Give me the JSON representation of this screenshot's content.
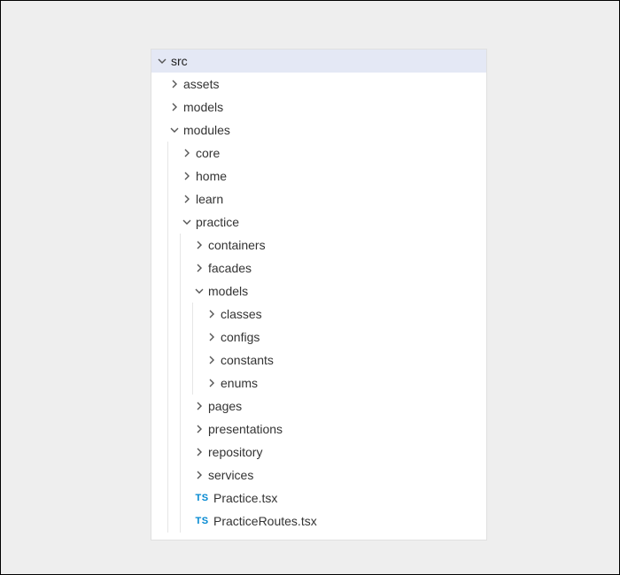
{
  "tree": [
    {
      "id": "src",
      "depth": 0,
      "type": "folder",
      "expanded": true,
      "selected": true,
      "label": "src"
    },
    {
      "id": "assets",
      "depth": 1,
      "type": "folder",
      "expanded": false,
      "selected": false,
      "label": "assets"
    },
    {
      "id": "models-top",
      "depth": 1,
      "type": "folder",
      "expanded": false,
      "selected": false,
      "label": "models"
    },
    {
      "id": "modules",
      "depth": 1,
      "type": "folder",
      "expanded": true,
      "selected": false,
      "label": "modules"
    },
    {
      "id": "core",
      "depth": 2,
      "type": "folder",
      "expanded": false,
      "selected": false,
      "label": "core"
    },
    {
      "id": "home",
      "depth": 2,
      "type": "folder",
      "expanded": false,
      "selected": false,
      "label": "home"
    },
    {
      "id": "learn",
      "depth": 2,
      "type": "folder",
      "expanded": false,
      "selected": false,
      "label": "learn"
    },
    {
      "id": "practice",
      "depth": 2,
      "type": "folder",
      "expanded": true,
      "selected": false,
      "label": "practice"
    },
    {
      "id": "containers",
      "depth": 3,
      "type": "folder",
      "expanded": false,
      "selected": false,
      "label": "containers"
    },
    {
      "id": "facades",
      "depth": 3,
      "type": "folder",
      "expanded": false,
      "selected": false,
      "label": "facades"
    },
    {
      "id": "models-practice",
      "depth": 3,
      "type": "folder",
      "expanded": true,
      "selected": false,
      "label": "models"
    },
    {
      "id": "classes",
      "depth": 4,
      "type": "folder",
      "expanded": false,
      "selected": false,
      "label": "classes"
    },
    {
      "id": "configs",
      "depth": 4,
      "type": "folder",
      "expanded": false,
      "selected": false,
      "label": "configs"
    },
    {
      "id": "constants",
      "depth": 4,
      "type": "folder",
      "expanded": false,
      "selected": false,
      "label": "constants"
    },
    {
      "id": "enums",
      "depth": 4,
      "type": "folder",
      "expanded": false,
      "selected": false,
      "label": "enums"
    },
    {
      "id": "pages",
      "depth": 3,
      "type": "folder",
      "expanded": false,
      "selected": false,
      "label": "pages"
    },
    {
      "id": "presentations",
      "depth": 3,
      "type": "folder",
      "expanded": false,
      "selected": false,
      "label": "presentations"
    },
    {
      "id": "repository",
      "depth": 3,
      "type": "folder",
      "expanded": false,
      "selected": false,
      "label": "repository"
    },
    {
      "id": "services",
      "depth": 3,
      "type": "folder",
      "expanded": false,
      "selected": false,
      "label": "services"
    },
    {
      "id": "practice-tsx",
      "depth": 3,
      "type": "file",
      "fileIcon": "TS",
      "selected": false,
      "label": "Practice.tsx"
    },
    {
      "id": "practice-routes",
      "depth": 3,
      "type": "file",
      "fileIcon": "TS",
      "selected": false,
      "label": "PracticeRoutes.tsx"
    }
  ],
  "icons": {
    "tsx": "TS"
  }
}
